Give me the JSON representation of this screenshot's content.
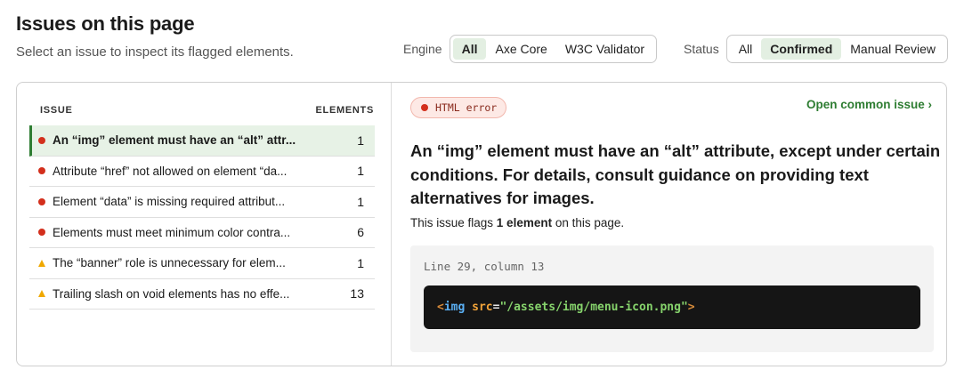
{
  "header": {
    "title": "Issues on this page",
    "subtitle": "Select an issue to inspect its flagged elements."
  },
  "filters": {
    "engine": {
      "label": "Engine",
      "options": [
        "All",
        "Axe Core",
        "W3C Validator"
      ],
      "selected": "All"
    },
    "status": {
      "label": "Status",
      "options": [
        "All",
        "Confirmed",
        "Manual Review"
      ],
      "selected": "Confirmed"
    }
  },
  "table": {
    "columns": {
      "issue": "ISSUE",
      "elements": "ELEMENTS"
    },
    "rows": [
      {
        "severity": "error",
        "label": "An “img” element must have an “alt” attr...",
        "count": "1",
        "selected": true
      },
      {
        "severity": "error",
        "label": "Attribute “href” not allowed on element “da...",
        "count": "1",
        "selected": false
      },
      {
        "severity": "error",
        "label": "Element “data” is missing required attribut...",
        "count": "1",
        "selected": false
      },
      {
        "severity": "error",
        "label": "Elements must meet minimum color contra...",
        "count": "6",
        "selected": false
      },
      {
        "severity": "warning",
        "label": "The “banner” role is unnecessary for elem...",
        "count": "1",
        "selected": false
      },
      {
        "severity": "warning",
        "label": "Trailing slash on void elements has no effe...",
        "count": "13",
        "selected": false
      }
    ]
  },
  "detail": {
    "badge": "HTML error",
    "open_link": "Open common issue ›",
    "title": "An “img” element must have an “alt” attribute, except under certain conditions. For details, consult guidance on providing text alternatives for images.",
    "summary_prefix": "This issue flags ",
    "summary_bold": "1 element",
    "summary_suffix": " on this page.",
    "location": "Line 29, column 13",
    "code": {
      "open": "<",
      "tag": "img",
      "attr": "src",
      "eq": "=",
      "value": "\"/assets/img/menu-icon.png\"",
      "close": ">"
    }
  },
  "colors": {
    "accent": "#2e7d32",
    "error": "#d32f1c",
    "warning": "#f0a800",
    "selected_bg": "#e7f2e6",
    "code_bg": "#151515"
  }
}
